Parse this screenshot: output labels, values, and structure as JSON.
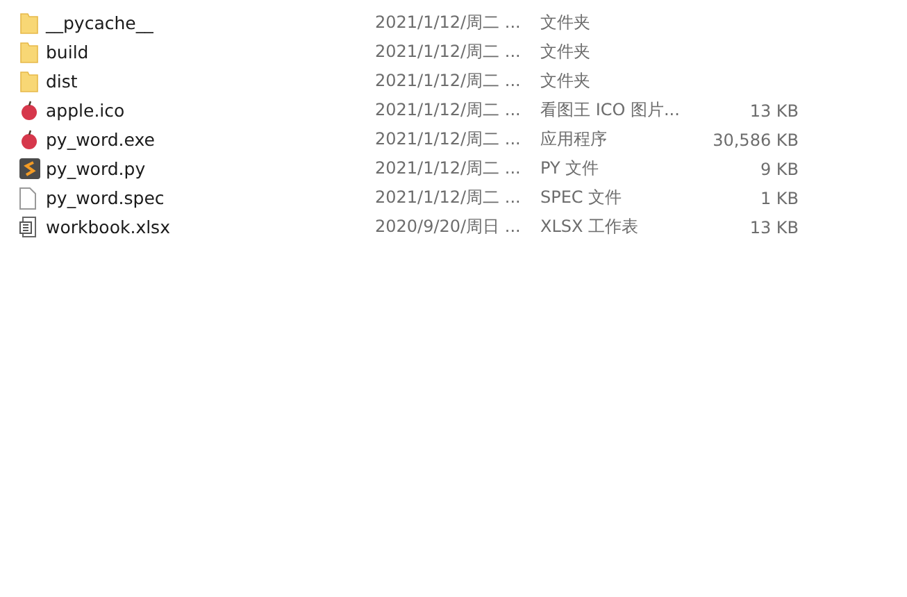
{
  "files": [
    {
      "name": "__pycache__",
      "kind": "folder",
      "modified": "2021/1/12/周二 ...",
      "type": "文件夹"
    },
    {
      "name": "build",
      "kind": "folder",
      "modified": "2021/1/12/周二 ...",
      "type": "文件夹"
    },
    {
      "name": "dist",
      "kind": "folder",
      "modified": "2021/1/12/周二 ...",
      "type": "文件夹"
    },
    {
      "name": "apple.ico",
      "kind": "apple",
      "modified": "2021/1/12/周二 ...",
      "type": "看图王 ICO 图片...",
      "size": "13 KB"
    },
    {
      "name": "py_word.exe",
      "kind": "apple",
      "modified": "2021/1/12/周二 ...",
      "type": "应用程序",
      "size": "30,586 KB"
    },
    {
      "name": "py_word.py",
      "kind": "script",
      "modified": "2021/1/12/周二 ...",
      "type": "PY 文件",
      "size": "9 KB"
    },
    {
      "name": "py_word.spec",
      "kind": "blank",
      "modified": "2021/1/12/周二 ...",
      "type": "SPEC 文件",
      "size": "1 KB"
    },
    {
      "name": "workbook.xlsx",
      "kind": "sheet",
      "modified": "2020/9/20/周日 ...",
      "type": "XLSX 工作表",
      "size": "13 KB"
    }
  ]
}
